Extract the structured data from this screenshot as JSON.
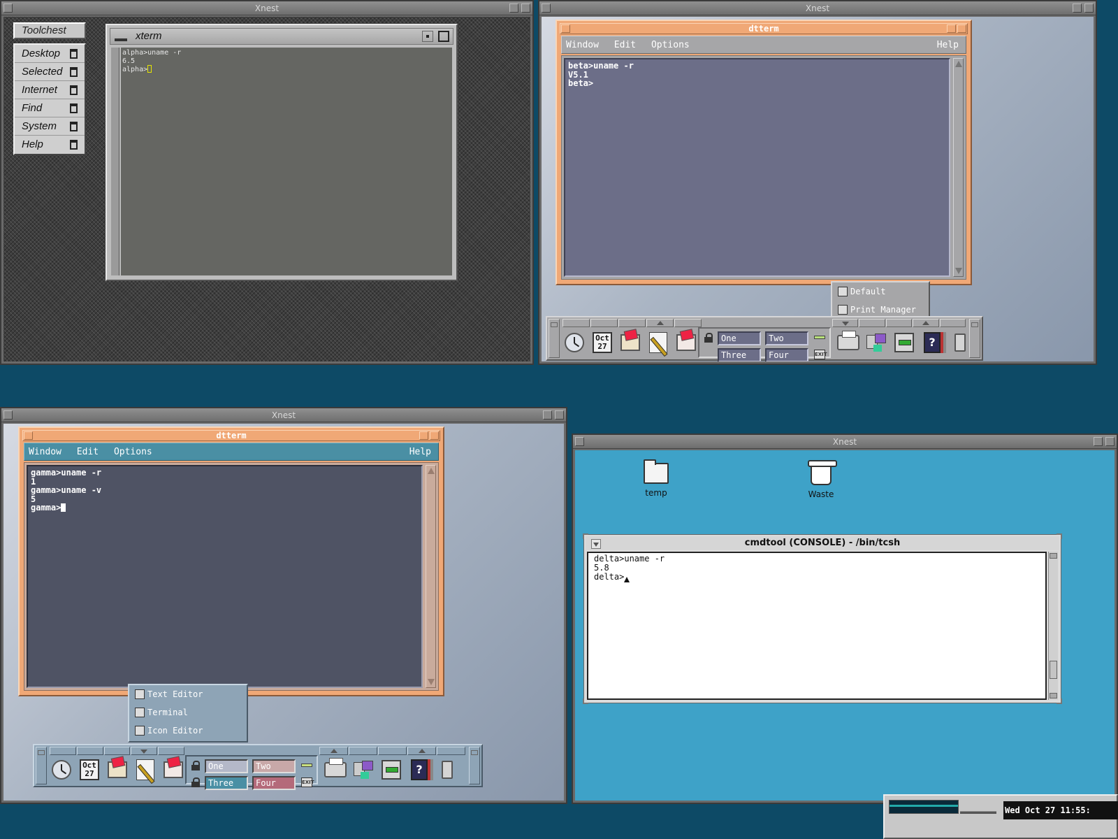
{
  "host_windows": {
    "alpha": {
      "title": "Xnest"
    },
    "beta": {
      "title": "Xnest"
    },
    "gamma": {
      "title": "Xnest"
    },
    "delta": {
      "title": "Xnest"
    }
  },
  "alpha": {
    "toolchest": {
      "title": "Toolchest",
      "items": [
        {
          "label": "Desktop"
        },
        {
          "label": "Selected"
        },
        {
          "label": "Internet"
        },
        {
          "label": "Find"
        },
        {
          "label": "System"
        },
        {
          "label": "Help"
        }
      ]
    },
    "xterm": {
      "title": "xterm",
      "lines": [
        "alpha>uname -r",
        "6.5",
        "alpha>"
      ]
    }
  },
  "beta": {
    "dtterm": {
      "title": "dtterm",
      "menu": {
        "window": "Window",
        "edit": "Edit",
        "options": "Options",
        "help": "Help"
      },
      "lines": [
        "beta>uname -r",
        "V5.1",
        "beta>"
      ]
    },
    "subpanel": {
      "items": [
        {
          "label": "Default",
          "icon": "printer-icon"
        },
        {
          "label": "Print Manager",
          "icon": "print-manager-icon"
        }
      ]
    },
    "front_panel": {
      "calendar": {
        "month": "Oct",
        "day": "27"
      },
      "workspaces": [
        "One",
        "Two",
        "Three",
        "Four"
      ],
      "exit_label": "EXIT"
    }
  },
  "gamma": {
    "dtterm": {
      "title": "dtterm",
      "menu": {
        "window": "Window",
        "edit": "Edit",
        "options": "Options",
        "help": "Help"
      },
      "lines": [
        "gamma>uname -r",
        "1",
        "gamma>uname -v",
        "5",
        "gamma>"
      ]
    },
    "subpanel": {
      "items": [
        {
          "label": "Text Editor",
          "icon": "text-editor-icon"
        },
        {
          "label": "Terminal",
          "icon": "terminal-icon"
        },
        {
          "label": "Icon Editor",
          "icon": "icon-editor-icon"
        }
      ]
    },
    "front_panel": {
      "calendar": {
        "month": "Oct",
        "day": "27"
      },
      "workspaces": [
        "One",
        "Two",
        "Three",
        "Four"
      ],
      "workspace_colors": [
        "#b4b8c8",
        "#c8a8a8",
        "#4a8fa4",
        "#b46a7a"
      ],
      "exit_label": "EXIT"
    }
  },
  "delta": {
    "desktop_icons": [
      {
        "label": "temp",
        "icon": "folder-icon"
      },
      {
        "label": "Waste",
        "icon": "wastebasket-icon"
      }
    ],
    "cmdtool": {
      "title": "cmdtool (CONSOLE) - /bin/tcsh",
      "lines": [
        "delta>uname -r",
        "5.8",
        "delta>"
      ]
    }
  },
  "taskbar": {
    "clock_text": "Wed Oct 27 11:55:"
  },
  "colors": {
    "host_background": "#0d4a66",
    "dtterm_frame": "#f0a876",
    "openwindows_desktop": "#3ea2c8",
    "irix_xterm_bg": "#656662"
  }
}
